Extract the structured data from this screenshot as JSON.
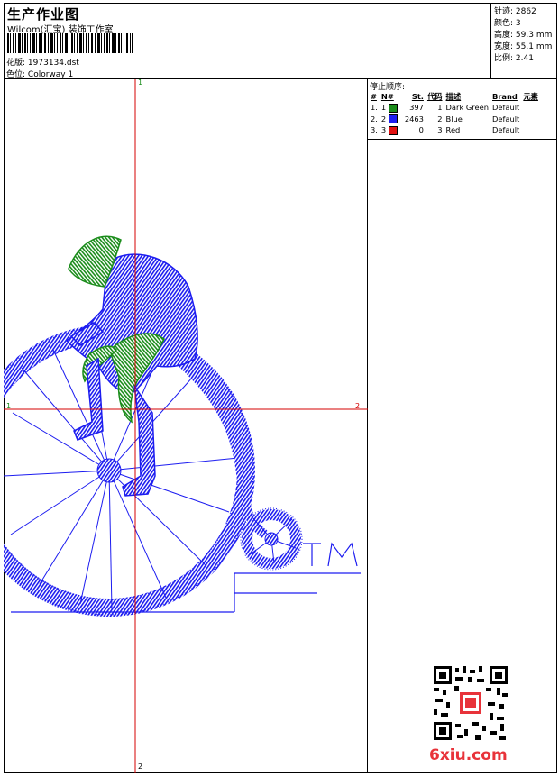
{
  "header": {
    "title": "生产作业图",
    "company": "Wilcom(汇宝) 装饰工作室",
    "design_label": "花版:",
    "design_value": "1973134.dst",
    "colorway_label": "色位:",
    "colorway_value": "Colorway 1"
  },
  "stats": {
    "stitches_label": "针迹:",
    "stitches_value": "2862",
    "colors_label": "颜色:",
    "colors_value": "3",
    "height_label": "高度:",
    "height_value": "59.3 mm",
    "width_label": "宽度:",
    "width_value": "55.1 mm",
    "scale_label": "比例:",
    "scale_value": "2.41"
  },
  "stop_sequence": {
    "title": "停止顺序:",
    "columns": [
      "#",
      "N#",
      "St.",
      "代码",
      "描述",
      "Brand",
      "元素"
    ],
    "rows": [
      {
        "idx": "1.",
        "n": "1",
        "color": "#1a8c1a",
        "st": "397",
        "code": "1",
        "desc": "Dark Green",
        "brand": "Default"
      },
      {
        "idx": "2.",
        "n": "2",
        "color": "#1c1cf0",
        "st": "2463",
        "code": "2",
        "desc": "Blue",
        "brand": "Default"
      },
      {
        "idx": "3.",
        "n": "3",
        "color": "#e01010",
        "st": "0",
        "code": "3",
        "desc": "Red",
        "brand": "Default"
      }
    ]
  },
  "axis_labels": {
    "top": "1",
    "bottom": "2",
    "left": "1",
    "right": "2"
  },
  "watermark": "6xiu.com"
}
